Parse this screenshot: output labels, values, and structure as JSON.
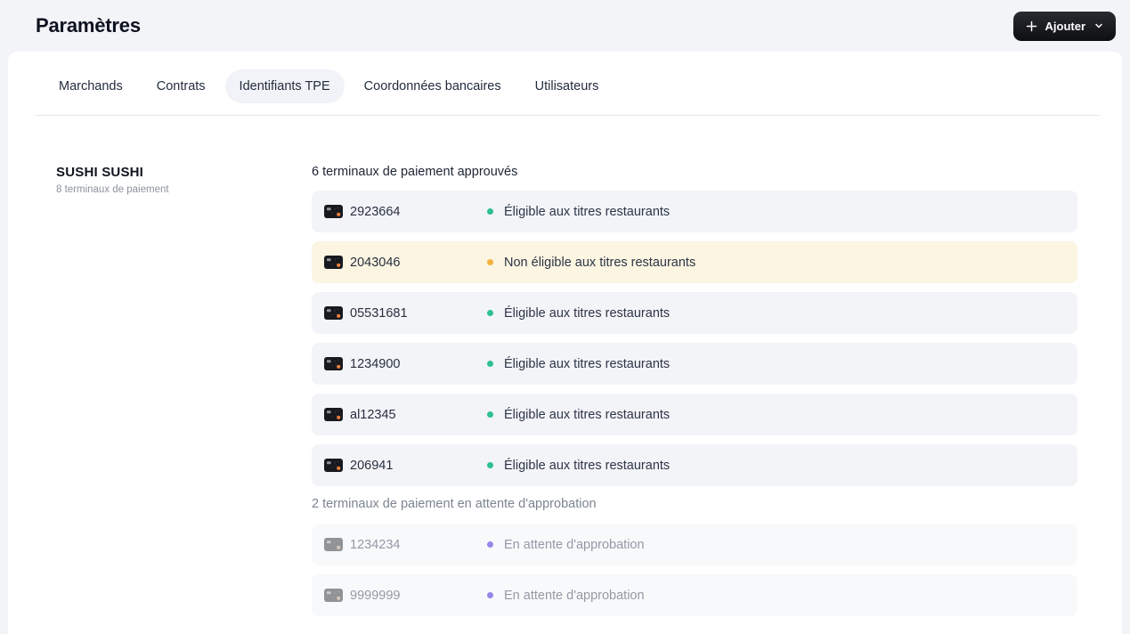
{
  "header": {
    "title": "Paramètres",
    "add_button": {
      "label": "Ajouter"
    }
  },
  "tabs": [
    {
      "label": "Marchands",
      "active": false
    },
    {
      "label": "Contrats",
      "active": false
    },
    {
      "label": "Identifiants TPE",
      "active": true
    },
    {
      "label": "Coordonnées bancaires",
      "active": false
    },
    {
      "label": "Utilisateurs",
      "active": false
    }
  ],
  "merchant": {
    "name": "SUSHI SUSHI",
    "subtitle": "8 terminaux de paiement"
  },
  "approved_section": {
    "heading": "6 terminaux de paiement approuvés",
    "terminals": [
      {
        "id": "2923664",
        "status": "Éligible aux titres restaurants",
        "status_type": "eligible"
      },
      {
        "id": "2043046",
        "status": "Non éligible aux titres restaurants",
        "status_type": "not_eligible"
      },
      {
        "id": "05531681",
        "status": "Éligible aux titres restaurants",
        "status_type": "eligible"
      },
      {
        "id": "1234900",
        "status": "Éligible aux titres restaurants",
        "status_type": "eligible"
      },
      {
        "id": "al12345",
        "status": "Éligible aux titres restaurants",
        "status_type": "eligible"
      },
      {
        "id": "206941",
        "status": "Éligible aux titres restaurants",
        "status_type": "eligible"
      }
    ]
  },
  "pending_section": {
    "heading": "2 terminaux de paiement en attente d'approbation",
    "terminals": [
      {
        "id": "1234234",
        "status": "En attente d'approbation",
        "status_type": "pending"
      },
      {
        "id": "9999999",
        "status": "En attente d'approbation",
        "status_type": "pending"
      }
    ]
  },
  "colors": {
    "status_eligible": "#2ebf8f",
    "status_not_eligible": "#f2b43e",
    "status_pending": "#9388ea",
    "row_bg": "#f3f4f8",
    "row_bg_warning": "#fcf5e2",
    "row_bg_pending": "#f8f9fb",
    "button_bg": "#121317",
    "page_bg": "#f3f4f7"
  }
}
